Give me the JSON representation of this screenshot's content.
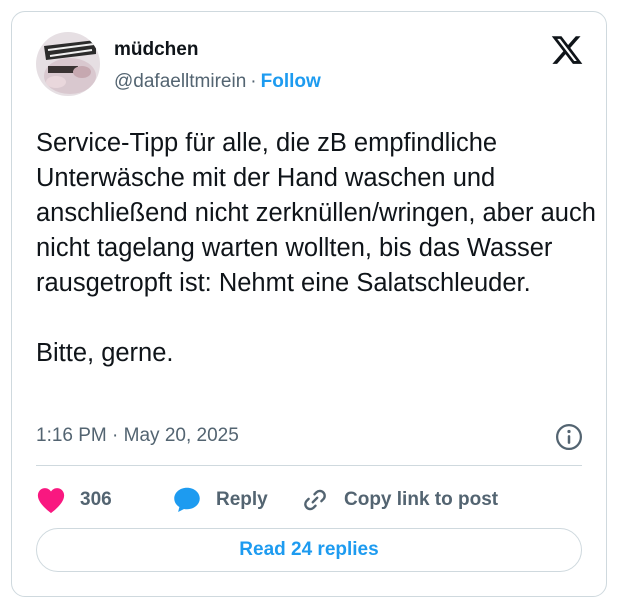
{
  "author": {
    "display_name": "müdchen",
    "handle": "@dafaelltmirein",
    "separator": "·",
    "follow_label": "Follow",
    "avatar_icon": "profile-photo-avatar"
  },
  "brand": {
    "logo_icon": "x-logo-icon"
  },
  "tweet": {
    "text": "Service-Tipp für alle, die zB empfindliche Unterwäsche mit der Hand waschen und anschließend nicht zerknüllen/wringen, aber auch nicht tagelang warten wollten, bis das Wasser rausgetropft ist: Nehmt eine Salatschleuder.\n\nBitte, gerne.",
    "time": "1:16 PM",
    "separator": "·",
    "date": "May 20, 2025",
    "info_icon": "info-icon"
  },
  "actions": {
    "like": {
      "count": "306",
      "icon": "heart-icon",
      "color": "#f91880"
    },
    "reply": {
      "label": "Reply",
      "icon": "speech-bubble-icon",
      "color": "#1d9bf0"
    },
    "copy": {
      "label": "Copy link to post",
      "icon": "link-icon"
    }
  },
  "read_replies": {
    "label": "Read 24 replies"
  },
  "colors": {
    "accent": "#1d9bf0",
    "muted": "#536471",
    "text": "#0f1419",
    "border": "#cfd9de"
  }
}
